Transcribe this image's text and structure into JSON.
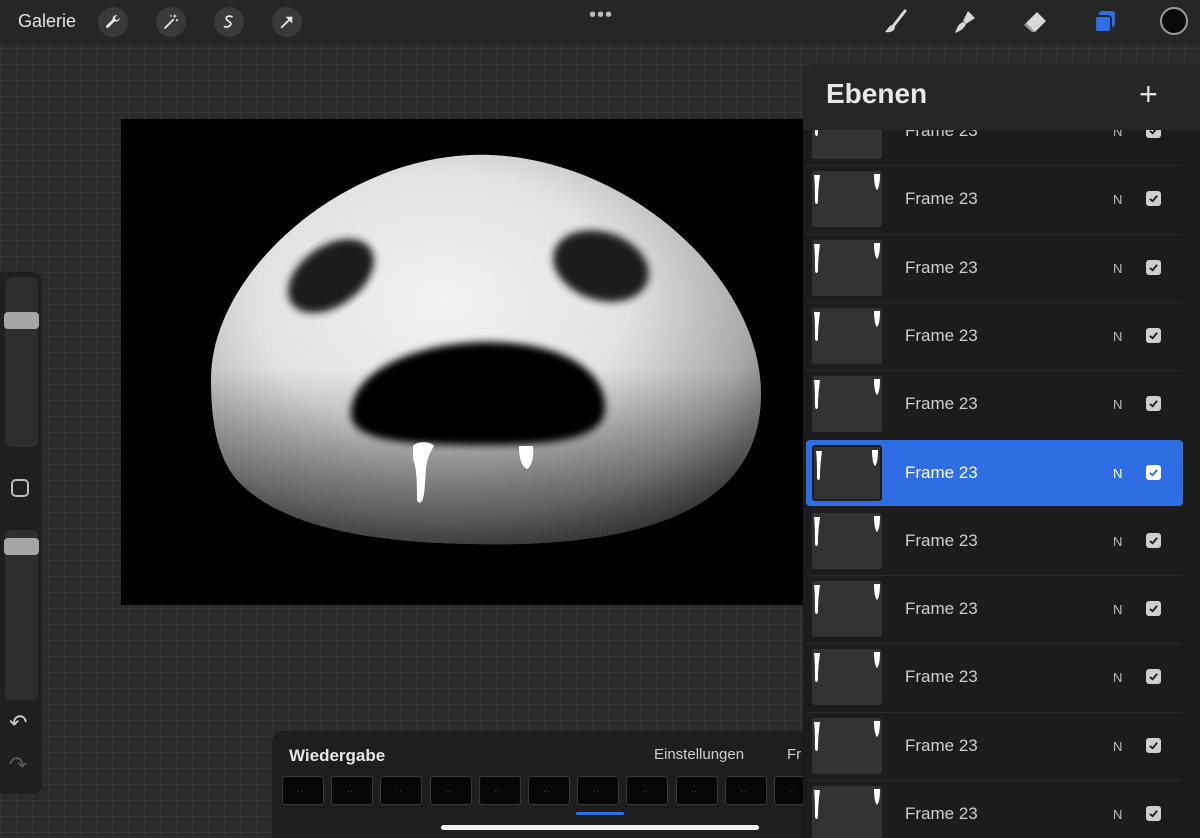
{
  "toolbar": {
    "gallery_label": "Galerie",
    "left_tools": [
      "wrench-icon",
      "magic-wand-icon",
      "selection-icon",
      "transform-arrow-icon"
    ],
    "more": "•••",
    "right_tools": [
      "brush-icon",
      "smudge-icon",
      "eraser-icon",
      "layers-icon",
      "color-icon"
    ],
    "active_tool": "layers-icon",
    "current_color": "#0a0a0a",
    "accent": "#2f6de2"
  },
  "sidebar": {
    "brush_size_level": 0.77,
    "opacity_level": 0.95,
    "undo_icon": "undo-icon",
    "redo_icon": "redo-icon"
  },
  "layers_panel": {
    "title": "Ebenen",
    "add_label": "+",
    "layers": [
      {
        "name": "Frame 23",
        "blend": "N",
        "visible": true,
        "selected": false
      },
      {
        "name": "Frame 23",
        "blend": "N",
        "visible": true,
        "selected": false
      },
      {
        "name": "Frame 23",
        "blend": "N",
        "visible": true,
        "selected": false
      },
      {
        "name": "Frame 23",
        "blend": "N",
        "visible": true,
        "selected": false
      },
      {
        "name": "Frame 23",
        "blend": "N",
        "visible": true,
        "selected": false
      },
      {
        "name": "Frame 23",
        "blend": "N",
        "visible": true,
        "selected": true
      },
      {
        "name": "Frame 23",
        "blend": "N",
        "visible": true,
        "selected": false
      },
      {
        "name": "Frame 23",
        "blend": "N",
        "visible": true,
        "selected": false
      },
      {
        "name": "Frame 23",
        "blend": "N",
        "visible": true,
        "selected": false
      },
      {
        "name": "Frame 23",
        "blend": "N",
        "visible": true,
        "selected": false
      },
      {
        "name": "Frame 23",
        "blend": "N",
        "visible": true,
        "selected": false
      }
    ]
  },
  "animation": {
    "title": "Wiedergabe",
    "settings_label": "Einstellungen",
    "next_label": "Fr",
    "frame_count": 11
  }
}
